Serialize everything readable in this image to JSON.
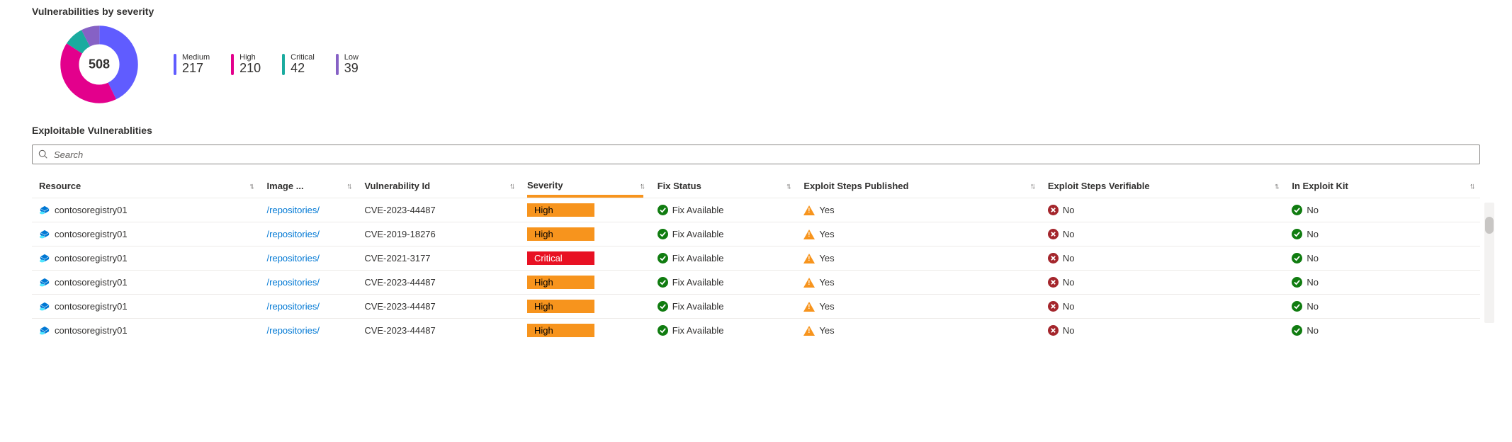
{
  "summary": {
    "title": "Vulnerabilities by severity",
    "total": "508",
    "legend": [
      {
        "label": "Medium",
        "value": "217",
        "color": "#605cff"
      },
      {
        "label": "High",
        "value": "210",
        "color": "#e3008c"
      },
      {
        "label": "Critical",
        "value": "42",
        "color": "#1aab9f"
      },
      {
        "label": "Low",
        "value": "39",
        "color": "#8661c5"
      }
    ]
  },
  "chart_data": {
    "type": "pie",
    "title": "Vulnerabilities by severity",
    "categories": [
      "Medium",
      "High",
      "Critical",
      "Low"
    ],
    "values": [
      217,
      210,
      42,
      39
    ],
    "colors": [
      "#605cff",
      "#e3008c",
      "#1aab9f",
      "#8661c5"
    ],
    "total": 508
  },
  "table": {
    "title": "Exploitable Vulnerablities",
    "search_placeholder": "Search",
    "columns": [
      {
        "key": "resource",
        "label": "Resource"
      },
      {
        "key": "image",
        "label": "Image ..."
      },
      {
        "key": "vulnId",
        "label": "Vulnerability Id"
      },
      {
        "key": "severity",
        "label": "Severity"
      },
      {
        "key": "fix",
        "label": "Fix Status"
      },
      {
        "key": "published",
        "label": "Exploit Steps Published"
      },
      {
        "key": "verifiable",
        "label": "Exploit Steps Verifiable"
      },
      {
        "key": "kit",
        "label": "In Exploit Kit"
      }
    ],
    "rows": [
      {
        "resource": "contosoregistry01",
        "image": "/repositories/",
        "vulnId": "CVE-2023-44487",
        "severity": "High",
        "fix": "Fix Available",
        "published": "Yes",
        "verifiable": "No",
        "kit": "No"
      },
      {
        "resource": "contosoregistry01",
        "image": "/repositories/",
        "vulnId": "CVE-2019-18276",
        "severity": "High",
        "fix": "Fix Available",
        "published": "Yes",
        "verifiable": "No",
        "kit": "No"
      },
      {
        "resource": "contosoregistry01",
        "image": "/repositories/",
        "vulnId": "CVE-2021-3177",
        "severity": "Critical",
        "fix": "Fix Available",
        "published": "Yes",
        "verifiable": "No",
        "kit": "No"
      },
      {
        "resource": "contosoregistry01",
        "image": "/repositories/",
        "vulnId": "CVE-2023-44487",
        "severity": "High",
        "fix": "Fix Available",
        "published": "Yes",
        "verifiable": "No",
        "kit": "No"
      },
      {
        "resource": "contosoregistry01",
        "image": "/repositories/",
        "vulnId": "CVE-2023-44487",
        "severity": "High",
        "fix": "Fix Available",
        "published": "Yes",
        "verifiable": "No",
        "kit": "No"
      },
      {
        "resource": "contosoregistry01",
        "image": "/repositories/",
        "vulnId": "CVE-2023-44487",
        "severity": "High",
        "fix": "Fix Available",
        "published": "Yes",
        "verifiable": "No",
        "kit": "No"
      }
    ]
  }
}
